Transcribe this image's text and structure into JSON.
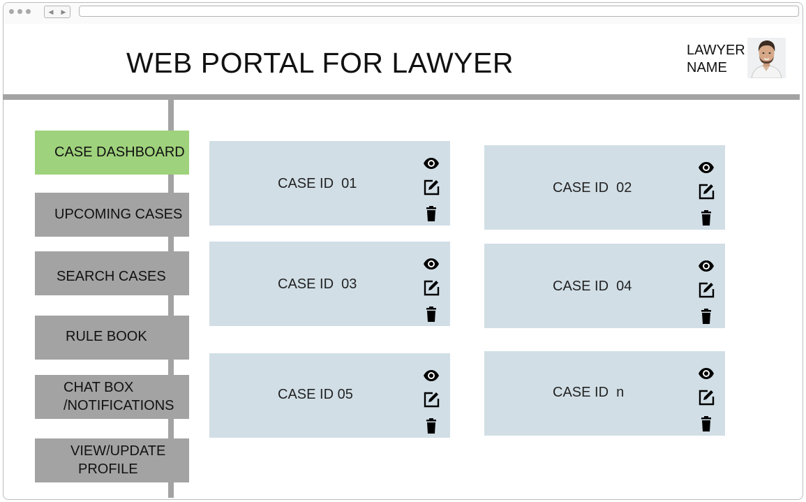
{
  "app": {
    "title": "WEB PORTAL FOR LAWYER",
    "user": {
      "line1": "LAWYER",
      "line2": "NAME"
    }
  },
  "sidebar": {
    "items": [
      {
        "lines": [
          "CASE DASHBOARD"
        ],
        "active": true
      },
      {
        "lines": [
          "UPCOMING CASES"
        ]
      },
      {
        "lines": [
          "SEARCH CASES"
        ]
      },
      {
        "lines": [
          "RULE BOOK"
        ]
      },
      {
        "lines": [
          "CHAT BOX",
          "/NOTIFICATIONS"
        ]
      },
      {
        "lines": [
          "VIEW/UPDATE",
          "PROFILE"
        ]
      }
    ]
  },
  "cases": [
    {
      "label": "CASE ID",
      "id": "01"
    },
    {
      "label": "CASE ID",
      "id": "02"
    },
    {
      "label": "CASE ID",
      "id": "03"
    },
    {
      "label": "CASE ID",
      "id": "04"
    },
    {
      "label": "CASE ID",
      "id": "05"
    },
    {
      "label": "CASE ID",
      "id": "n"
    }
  ],
  "card_actions": [
    "eye-icon",
    "edit-icon",
    "trash-icon"
  ],
  "colors": {
    "active_nav": "#9fd27c",
    "nav": "#a3a3a3",
    "card": "#d1dee6",
    "divider": "#a3a3a3"
  }
}
